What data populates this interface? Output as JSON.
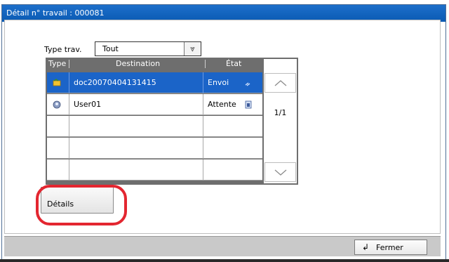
{
  "window": {
    "title": "Détail n° travail :  000081"
  },
  "filter": {
    "label": "Type trav.",
    "selected": "Tout",
    "dropdown_icon": "double-chevron-down-icon"
  },
  "job_list": {
    "columns": [
      "Type",
      "Destination",
      "État"
    ],
    "rows": [
      {
        "type_icon": "send-folder-icon",
        "destination": "doc20070404131415",
        "state": "Envoi",
        "state_icon": "sending-icon",
        "selected": true
      },
      {
        "type_icon": "user-box-icon",
        "destination": "User01",
        "state": "Attente",
        "state_icon": "waiting-icon",
        "selected": false
      },
      {
        "type_icon": "",
        "destination": "",
        "state": "",
        "state_icon": "",
        "selected": false
      },
      {
        "type_icon": "",
        "destination": "",
        "state": "",
        "state_icon": "",
        "selected": false
      },
      {
        "type_icon": "",
        "destination": "",
        "state": "",
        "state_icon": "",
        "selected": false
      }
    ],
    "page_indicator": "1/1"
  },
  "actions": {
    "details_label": "Détails",
    "close_label": "Fermer",
    "close_icon": "return-arrow-icon"
  },
  "colors": {
    "titlebar": "#0a5ab3",
    "selection": "#1b64c8",
    "highlight_ring": "#e32630"
  }
}
